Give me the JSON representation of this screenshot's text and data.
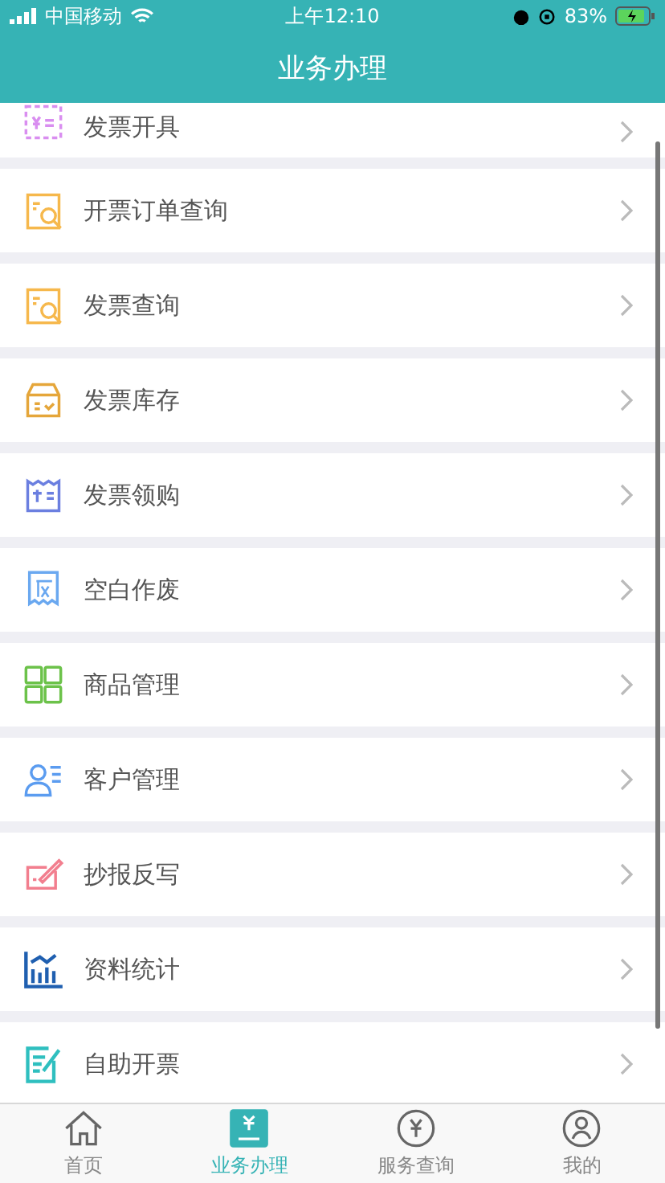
{
  "status_bar": {
    "carrier": "中国移动",
    "time": "上午12:10",
    "battery": "83%"
  },
  "nav_bar": {
    "title": "业务办理"
  },
  "items": [
    {
      "label": "发票开具",
      "kind": "issue"
    },
    {
      "label": "开票订单查询",
      "kind": "search"
    },
    {
      "label": "发票查询",
      "kind": "search"
    },
    {
      "label": "发票库存",
      "kind": "stock"
    },
    {
      "label": "发票领购",
      "kind": "purchase"
    },
    {
      "label": "空白作废",
      "kind": "void"
    },
    {
      "label": "商品管理",
      "kind": "grid"
    },
    {
      "label": "客户管理",
      "kind": "customer"
    },
    {
      "label": "抄报反写",
      "kind": "write"
    },
    {
      "label": "资料统计",
      "kind": "stats"
    },
    {
      "label": "自助开票",
      "kind": "self"
    }
  ],
  "tab_bar": [
    {
      "label": "首页",
      "kind": "home",
      "selected": false
    },
    {
      "label": "业务办理",
      "kind": "business",
      "selected": true
    },
    {
      "label": "服务查询",
      "kind": "service",
      "selected": false
    },
    {
      "label": "我的",
      "kind": "me",
      "selected": false
    }
  ]
}
